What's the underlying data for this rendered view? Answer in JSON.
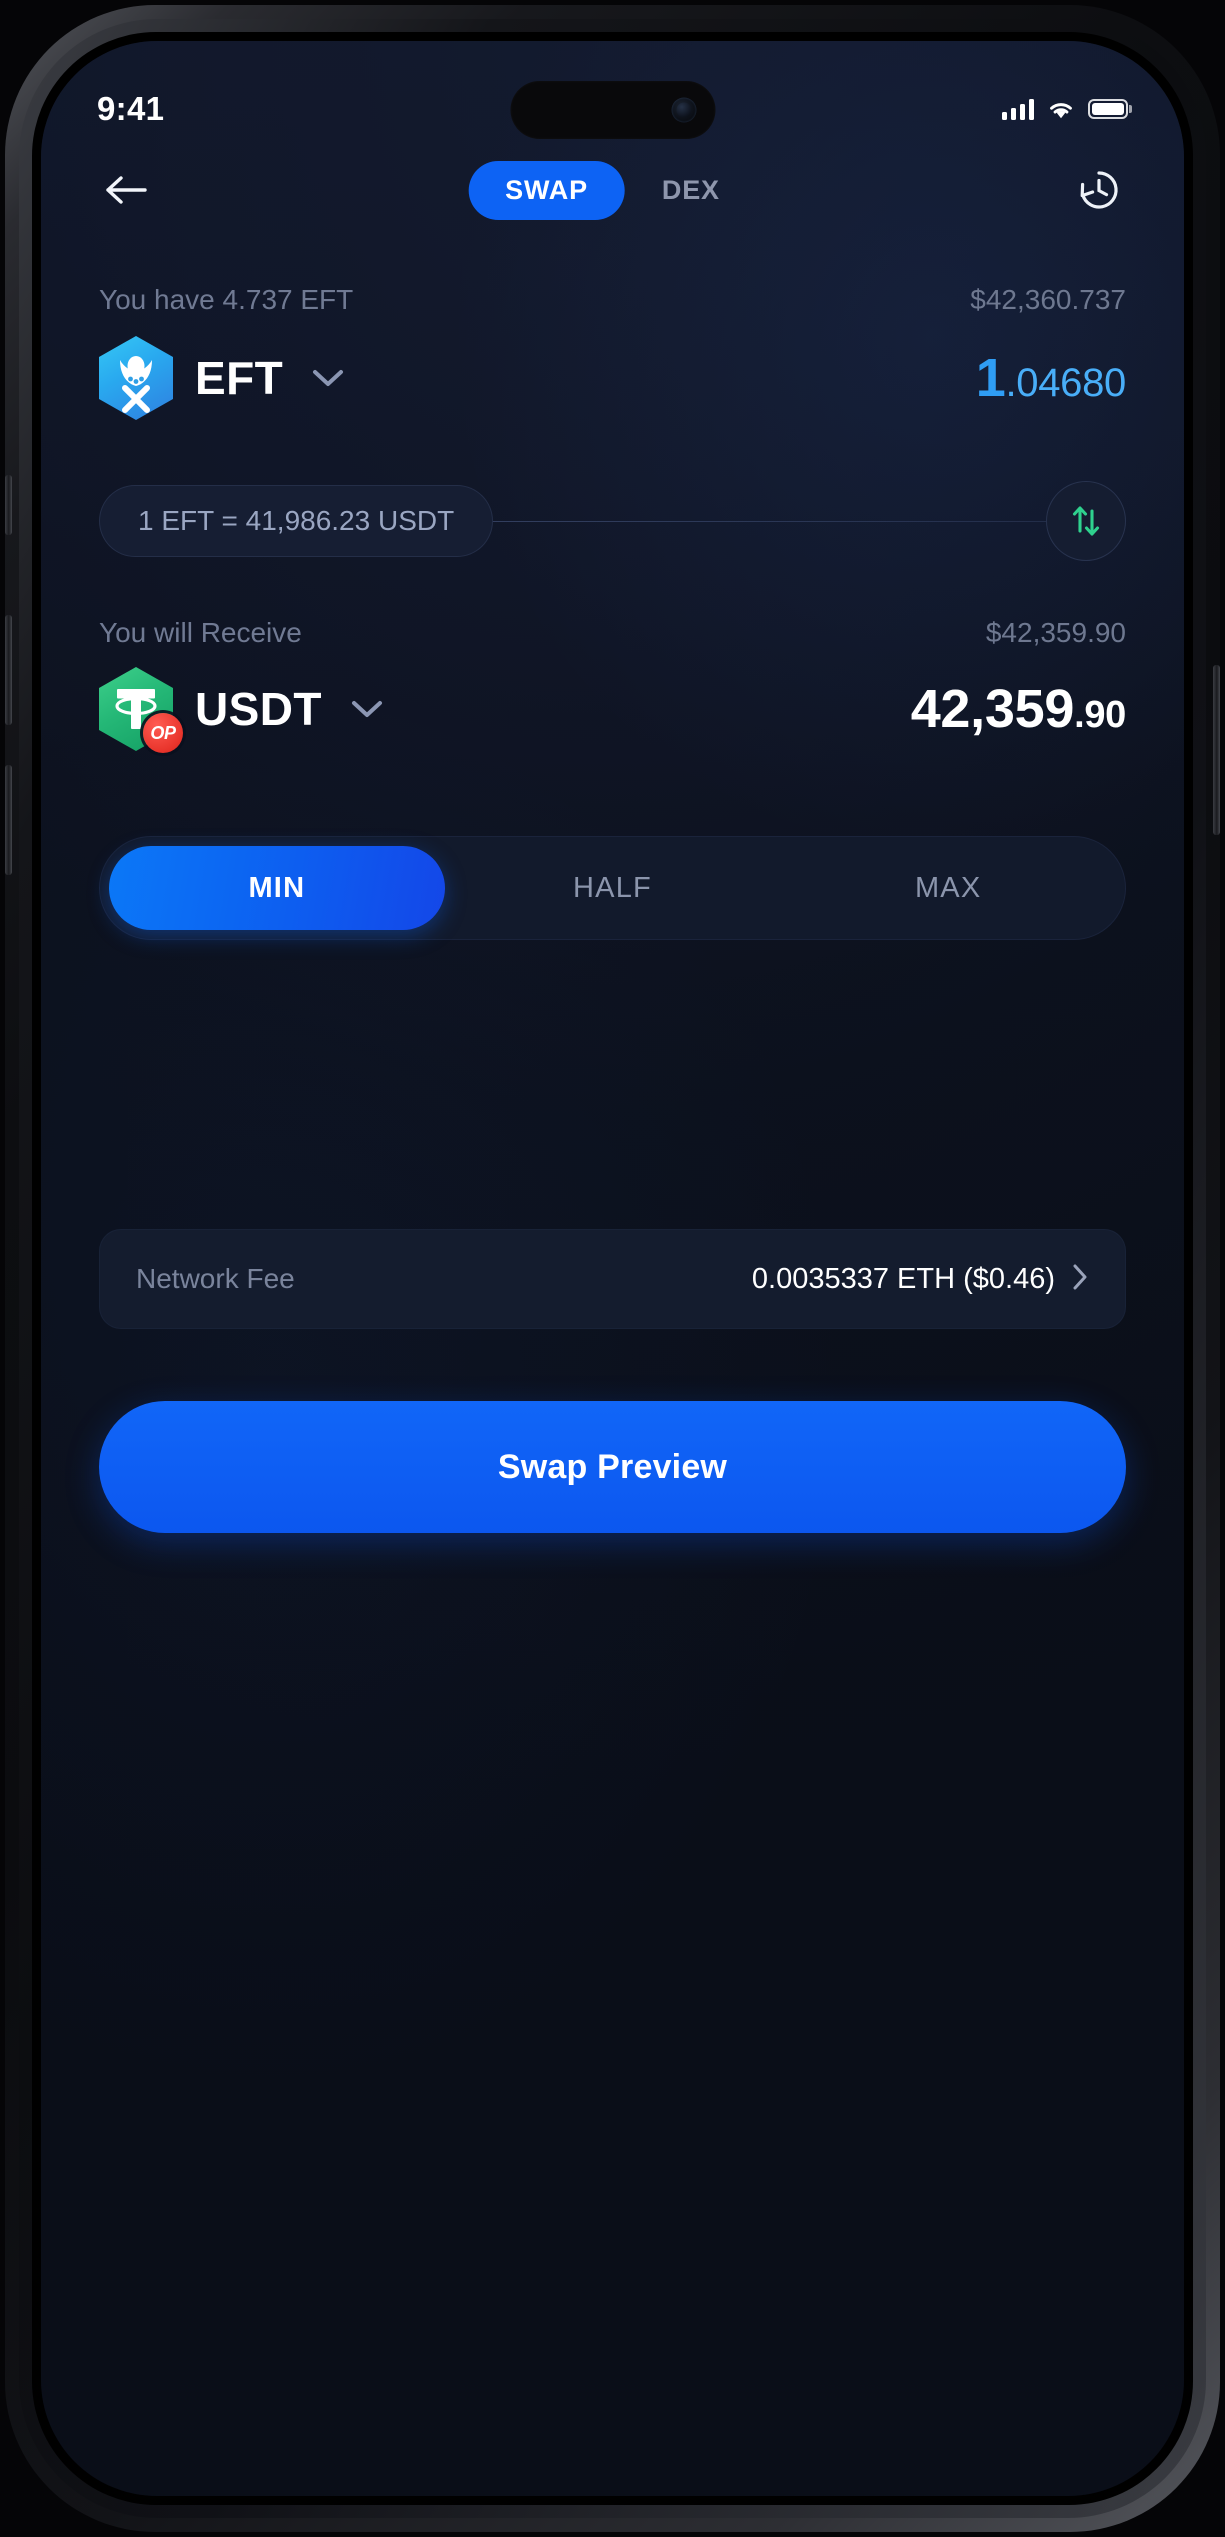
{
  "status_bar": {
    "time": "9:41",
    "signal_icon": "cellular-signal-icon",
    "wifi_icon": "wifi-icon",
    "battery_icon": "battery-icon"
  },
  "nav": {
    "back_icon": "back-arrow-icon",
    "history_icon": "history-clock-icon",
    "tabs": [
      {
        "label": "SWAP",
        "active": true
      },
      {
        "label": "DEX",
        "active": false
      }
    ]
  },
  "from": {
    "balance_label": "You have 4.737 EFT",
    "fiat_value": "$42,360.737",
    "token_symbol": "EFT",
    "token_icon": "eft-token-icon",
    "dropdown_icon": "chevron-down-icon",
    "amount_integer": "1",
    "amount_fraction": ".04680"
  },
  "rate": {
    "text": "1 EFT = 41,986.23 USDT",
    "swap_icon": "swap-direction-icon"
  },
  "to": {
    "balance_label": "You will Receive",
    "fiat_value": "$42,359.90",
    "token_symbol": "USDT",
    "token_icon": "usdt-token-icon",
    "network_badge": "OP",
    "dropdown_icon": "chevron-down-icon",
    "amount_integer": "42,359",
    "amount_fraction": ".90"
  },
  "percent_selector": {
    "options": [
      {
        "label": "MIN",
        "active": true
      },
      {
        "label": "HALF",
        "active": false
      },
      {
        "label": "MAX",
        "active": false
      }
    ]
  },
  "network_fee": {
    "label": "Network Fee",
    "value": "0.0035337 ETH ($0.46)",
    "chevron_icon": "chevron-right-icon"
  },
  "cta": {
    "label": "Swap Preview"
  },
  "colors": {
    "accent_blue": "#0d63f4",
    "amount_blue": "#2f9df4",
    "screen_bg": "#0b1020",
    "card_bg": "#141c2e",
    "muted_text": "#7a849c"
  }
}
